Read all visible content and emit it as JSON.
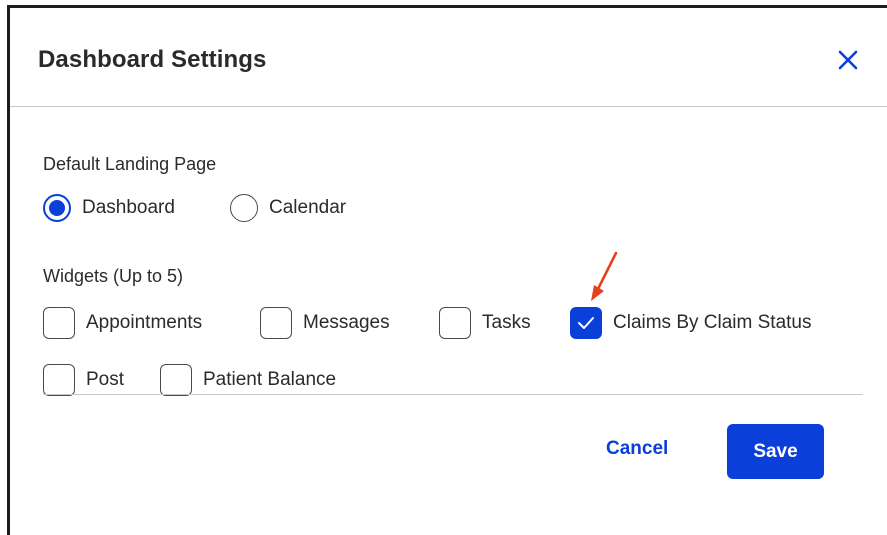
{
  "dialog": {
    "title": "Dashboard Settings",
    "close_icon": "close-icon"
  },
  "landing": {
    "label": "Default Landing Page",
    "options": [
      {
        "label": "Dashboard",
        "selected": true
      },
      {
        "label": "Calendar",
        "selected": false
      }
    ]
  },
  "widgets": {
    "label": "Widgets (Up to 5)",
    "items": [
      {
        "label": "Appointments",
        "checked": false
      },
      {
        "label": "Messages",
        "checked": false
      },
      {
        "label": "Tasks",
        "checked": false
      },
      {
        "label": "Claims By Claim Status",
        "checked": true
      },
      {
        "label": "Post",
        "checked": false
      },
      {
        "label": "Patient Balance",
        "checked": false
      }
    ]
  },
  "footer": {
    "cancel_label": "Cancel",
    "save_label": "Save"
  },
  "colors": {
    "accent": "#0a3fd9",
    "annotation": "#e8401c"
  }
}
